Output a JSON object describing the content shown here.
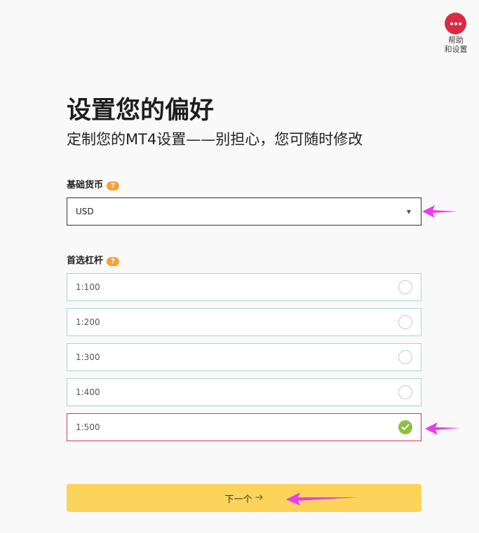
{
  "help": {
    "label_line1": "帮助",
    "label_line2": "和设置",
    "icon": "more-dots-icon",
    "color": "#dc2a45"
  },
  "page": {
    "title": "设置您的偏好",
    "subtitle": "定制您的MT4设置——别担心，您可随时修改"
  },
  "currency": {
    "label": "基础货币",
    "help_icon": "?",
    "value": "USD",
    "icon": "caret-down-icon"
  },
  "leverage": {
    "label": "首选杠杆",
    "help_icon": "?",
    "options": [
      {
        "label": "1:100",
        "selected": false
      },
      {
        "label": "1:200",
        "selected": false
      },
      {
        "label": "1:300",
        "selected": false
      },
      {
        "label": "1:400",
        "selected": false
      },
      {
        "label": "1:500",
        "selected": true
      }
    ]
  },
  "next_button": {
    "label": "下一个",
    "icon": "arrow-right-icon",
    "color": "#fcd45a"
  },
  "colors": {
    "accent_red": "#d9324a",
    "option_border": "#a8d5c0",
    "check_green": "#8dc03f",
    "help_orange": "#f3a23a",
    "annotation_magenta": "#e83cf0"
  }
}
